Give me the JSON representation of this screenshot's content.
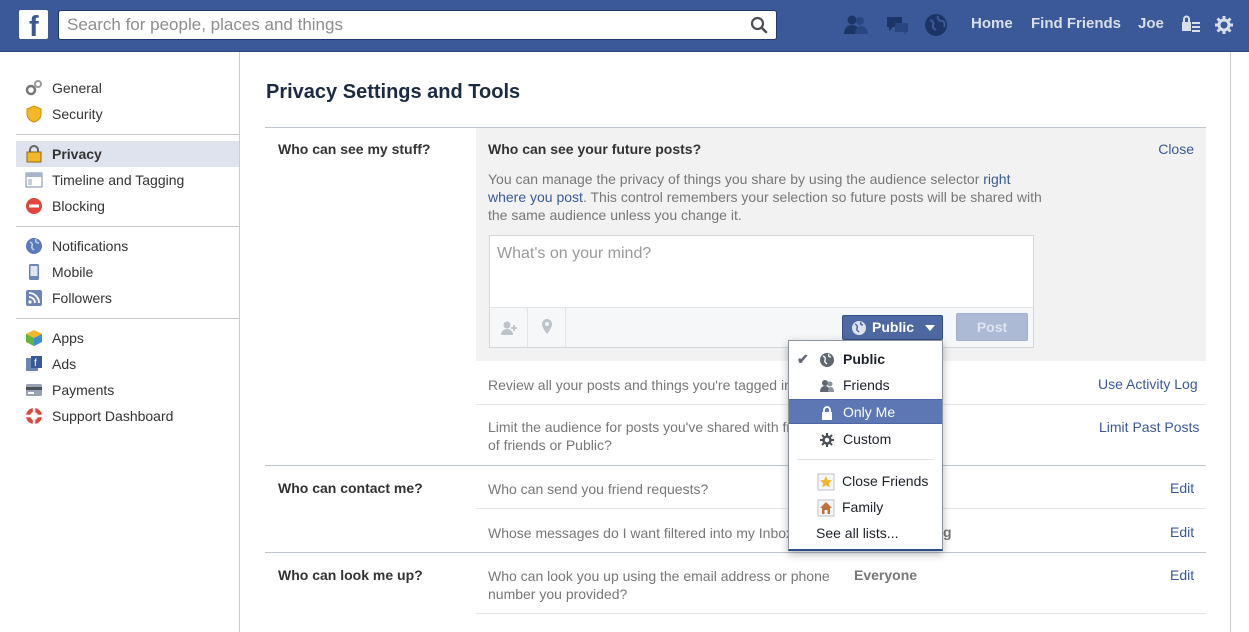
{
  "topbar": {
    "search_placeholder": "Search for people, places and things",
    "links": {
      "home": "Home",
      "find_friends": "Find Friends",
      "profile": "Joe"
    }
  },
  "sidebar": {
    "groups": [
      [
        {
          "label": "General",
          "icon": "gears-icon"
        },
        {
          "label": "Security",
          "icon": "shield-icon"
        }
      ],
      [
        {
          "label": "Privacy",
          "icon": "lock-icon",
          "selected": true
        },
        {
          "label": "Timeline and Tagging",
          "icon": "timeline-icon"
        },
        {
          "label": "Blocking",
          "icon": "block-icon"
        }
      ],
      [
        {
          "label": "Notifications",
          "icon": "globe-icon"
        },
        {
          "label": "Mobile",
          "icon": "phone-icon"
        },
        {
          "label": "Followers",
          "icon": "rss-icon"
        }
      ],
      [
        {
          "label": "Apps",
          "icon": "cube-icon"
        },
        {
          "label": "Ads",
          "icon": "ads-icon"
        },
        {
          "label": "Payments",
          "icon": "card-icon"
        },
        {
          "label": "Support Dashboard",
          "icon": "lifebuoy-icon"
        }
      ]
    ]
  },
  "main": {
    "title": "Privacy Settings and Tools",
    "sections": {
      "stuff": {
        "label": "Who can see my stuff?",
        "expanded": {
          "title": "Who can see your future posts?",
          "close": "Close",
          "desc_before": "You can manage the privacy of things you share by using the audience selector ",
          "desc_link": "right where you post",
          "desc_after": ". This control remembers your selection so future posts will be shared with the same audience unless you change it.",
          "composer_placeholder": "What's on your mind?",
          "audience_label": "Public",
          "post_label": "Post"
        },
        "rows": [
          {
            "text": "Review all your posts and things you're tagged in",
            "action": "Use Activity Log"
          },
          {
            "text": "Limit the audience for posts you've shared with friends of friends or Public?",
            "text_line1": "Limit the audience for posts you've shared with fr",
            "text_line2": "of friends or Public?",
            "action": "Limit Past Posts"
          }
        ]
      },
      "contact": {
        "label": "Who can contact me?",
        "rows": [
          {
            "text": "Who can send you friend requests?",
            "action": "Edit"
          },
          {
            "text": "Whose messages do I want filtered into my Inbox",
            "value_tail": "g",
            "action": "Edit"
          }
        ]
      },
      "lookup": {
        "label": "Who can look me up?",
        "rows": [
          {
            "text_line1": "Who can look you up using the email address or phone",
            "text_line2": "number you provided?",
            "value": "Everyone",
            "action": "Edit"
          }
        ]
      }
    }
  },
  "dropdown": {
    "items": [
      {
        "label": "Public",
        "icon": "globe-icon",
        "checked": true
      },
      {
        "label": "Friends",
        "icon": "friends-icon"
      },
      {
        "label": "Only Me",
        "icon": "lock-icon",
        "active": true
      },
      {
        "label": "Custom",
        "icon": "gear-icon"
      },
      {
        "label": "Close Friends",
        "icon": "star-icon"
      },
      {
        "label": "Family",
        "icon": "house-icon"
      }
    ],
    "see_all": "See all lists..."
  }
}
